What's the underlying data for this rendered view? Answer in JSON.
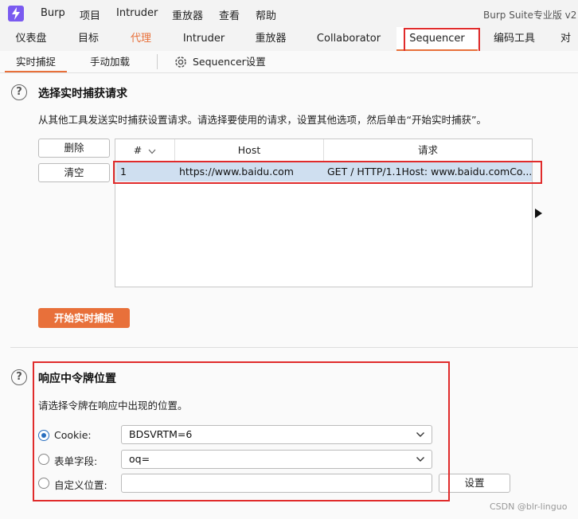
{
  "menubar": {
    "items": [
      "Burp",
      "项目",
      "Intruder",
      "重放器",
      "查看",
      "帮助"
    ],
    "app_title": "Burp Suite专业版  v2"
  },
  "main_tabs": [
    "仪表盘",
    "目标",
    "代理",
    "Intruder",
    "重放器",
    "Collaborator",
    "Sequencer",
    "编码工具",
    "对"
  ],
  "sub_tabs": {
    "live_capture": "实时捕捉",
    "manual_load": "手动加载",
    "settings": "Sequencer设置"
  },
  "capture_section": {
    "title": "选择实时捕获请求",
    "description": "从其他工具发送实时捕获设置请求。请选择要使用的请求，设置其他选项，然后单击“开始实时捕获”。",
    "remove_label": "删除",
    "clear_label": "清空",
    "table": {
      "columns": [
        "#",
        "Host",
        "请求"
      ],
      "rows": [
        {
          "num": "1",
          "host": "https://www.baidu.com",
          "request": "GET / HTTP/1.1Host: www.baidu.comCo..."
        }
      ]
    },
    "start_label": "开始实时捕捉"
  },
  "token_section": {
    "title": "响应中令牌位置",
    "description": "请选择令牌在响应中出现的位置。",
    "options": [
      {
        "label": "Cookie:",
        "value": "BDSVRTM=6",
        "checked": true
      },
      {
        "label": "表单字段:",
        "value": "oq=",
        "checked": false
      },
      {
        "label": "自定义位置:",
        "value": "",
        "checked": false
      }
    ],
    "configure_label": "设置"
  },
  "watermark": "CSDN @blr-linguo",
  "colors": {
    "accent": "#e8703a",
    "selection": "#cfdff0",
    "highlight_box": "#e02b2b"
  }
}
